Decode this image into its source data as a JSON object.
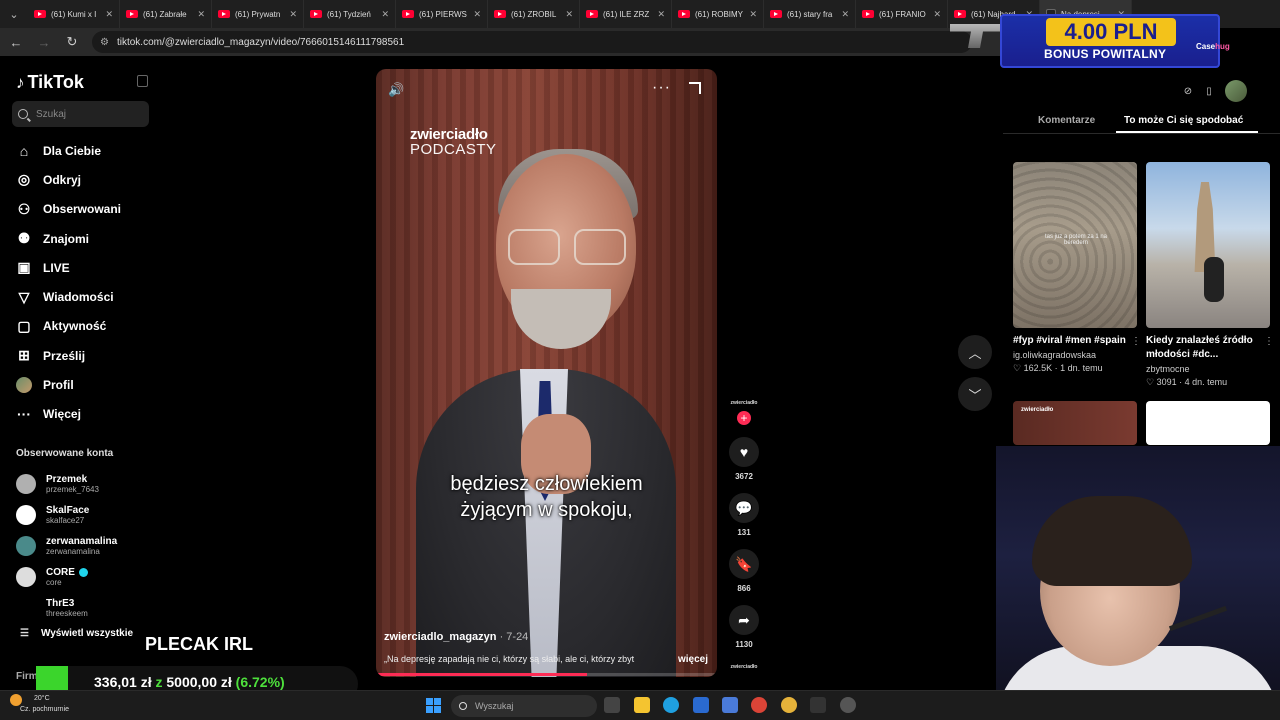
{
  "browser": {
    "tabs": [
      {
        "label": "(61) Kumi x I",
        "type": "youtube"
      },
      {
        "label": "(61) Zabrałe",
        "type": "youtube"
      },
      {
        "label": "(61) Prywatn",
        "type": "youtube"
      },
      {
        "label": "(61) Tydzień",
        "type": "youtube"
      },
      {
        "label": "(61) PIERWS",
        "type": "youtube"
      },
      {
        "label": "(61) ZROBIL",
        "type": "youtube"
      },
      {
        "label": "(61) ILE ZRZ",
        "type": "youtube"
      },
      {
        "label": "(61) ROBIMY",
        "type": "youtube"
      },
      {
        "label": "(61) stary fra",
        "type": "youtube"
      },
      {
        "label": "(61) FRANIO",
        "type": "youtube"
      },
      {
        "label": "(61) Najbard",
        "type": "youtube"
      },
      {
        "label": "Na depresj",
        "type": "tiktok",
        "active": true
      }
    ],
    "url": "tiktok.com/@zwierciadlo_magazyn/video/7666015146111798561"
  },
  "sidebar": {
    "logo": "TikTok",
    "search_placeholder": "Szukaj",
    "nav": [
      {
        "label": "Dla Ciebie",
        "icon": "home-icon"
      },
      {
        "label": "Odkryj",
        "icon": "compass-icon"
      },
      {
        "label": "Obserwowani",
        "icon": "following-icon"
      },
      {
        "label": "Znajomi",
        "icon": "friends-icon"
      },
      {
        "label": "LIVE",
        "icon": "live-icon"
      },
      {
        "label": "Wiadomości",
        "icon": "messages-icon"
      },
      {
        "label": "Aktywność",
        "icon": "activity-icon"
      },
      {
        "label": "Prześlij",
        "icon": "upload-icon"
      },
      {
        "label": "Profil",
        "icon": "profile-avatar"
      },
      {
        "label": "Więcej",
        "icon": "more-icon"
      }
    ],
    "followed_title": "Obserwowane konta",
    "followed": [
      {
        "name": "Przemek",
        "handle": "przemek_7643",
        "color": "#b0b0b0"
      },
      {
        "name": "SkalFace",
        "handle": "skalface27",
        "color": "#ffffff"
      },
      {
        "name": "zerwanamalina",
        "handle": "zerwanamalina",
        "color": "#4a8a8a"
      },
      {
        "name": "CORE",
        "handle": "core",
        "verified": true,
        "color": "#dddddd"
      },
      {
        "name": "ThrE3",
        "handle": "threeskeem",
        "color": "#000000"
      }
    ],
    "see_all": "Wyświetl wszystkie",
    "footer": "Firma"
  },
  "video": {
    "brand_line1": "zwierciadło",
    "brand_line2": "PODCASTY",
    "subtitle_line1": "będziesz człowiekiem",
    "subtitle_line2": "żyjącym w spokoju,",
    "author": "zwierciadlo_magazyn",
    "date": "· 7-24",
    "caption": "„Na depresję zapadają nie ci, którzy są słabi, ale ci, którzy zbyt",
    "more": "więcej",
    "progress": 0.62
  },
  "actions": {
    "brand": "zwierciadło",
    "likes": "3672",
    "comments": "131",
    "saves": "866",
    "shares": "1130"
  },
  "right_panel": {
    "tabs": [
      "Komentarze",
      "To może Ci się spodobać"
    ],
    "active_tab": 1,
    "cards": [
      {
        "title": "#fyp #viral #men #spain",
        "user": "ig.oliwkagradowskaa",
        "likes": "162.5K",
        "age": "1 dn. temu",
        "overlay": "tas juz a potem za 1 na beredern"
      },
      {
        "title": "Kiedy znalazłeś źródło młodości #dc...",
        "user": "zbytmocne",
        "likes": "3091",
        "age": "4 dn. temu"
      },
      {
        "brand": "zwierciadło"
      },
      {}
    ]
  },
  "overlays": {
    "promo_amount": "4.00 PLN",
    "promo_text": "BONUS POWITALNY",
    "promo_logo_a": "Case",
    "promo_logo_b": "hug",
    "donate_title": "PLECAK IRL",
    "goal_current": "336,01 zł",
    "goal_sep": "z",
    "goal_target": "5000,00 zł",
    "goal_percent": "(6.72%)",
    "goal_fraction": 0.0672
  },
  "taskbar": {
    "temperature": "20°C",
    "weather": "Cz. pochmurnie",
    "search_placeholder": "Wyszukaj"
  }
}
